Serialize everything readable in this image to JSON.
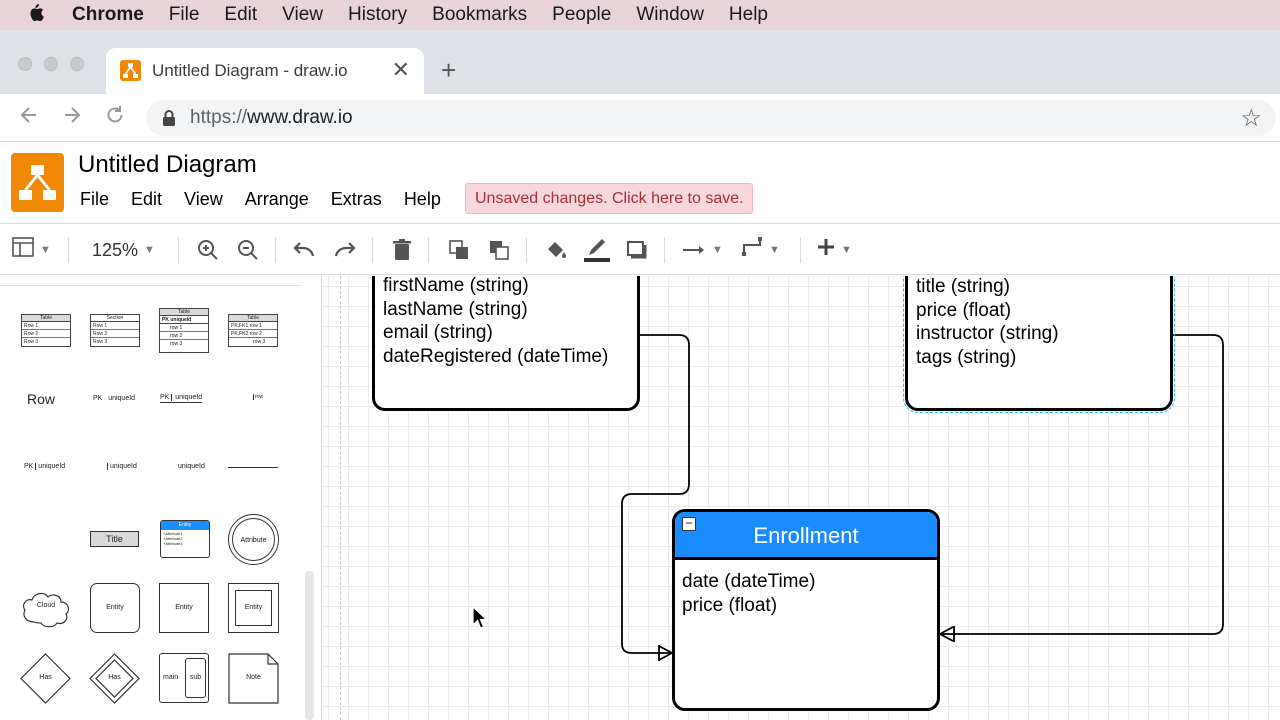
{
  "menubar": {
    "app": "Chrome",
    "items": [
      "File",
      "Edit",
      "View",
      "History",
      "Bookmarks",
      "People",
      "Window",
      "Help"
    ]
  },
  "browser": {
    "tab_title": "Untitled Diagram - draw.io",
    "url_scheme": "https://",
    "url_host": "www.draw.io"
  },
  "app": {
    "title": "Untitled Diagram",
    "menu": [
      "File",
      "Edit",
      "View",
      "Arrange",
      "Extras",
      "Help"
    ],
    "unsaved_notice": "Unsaved changes. Click here to save.",
    "zoom": "125%"
  },
  "sidebar": {
    "tables": [
      "Table",
      "Section",
      "Table",
      "Table"
    ],
    "table_rows": [
      "Row 1",
      "Row 2",
      "Row 3"
    ],
    "table3_header": [
      "PK",
      "uniqueId"
    ],
    "table3_rows": [
      "row 1",
      "row 2",
      "row 3"
    ],
    "table4_rows": [
      "PK,FK1",
      "PK,FK2",
      "row 1",
      "row 2",
      "row 3"
    ],
    "row_label": "Row",
    "pk": "PK",
    "unique_id": "uniqueId",
    "row_small": "row",
    "title_shape": "Title",
    "entity_header": "Entity",
    "entity_attrs": [
      "+Attribute1",
      "+Attribute2",
      "+Attribute3"
    ],
    "attribute": "Attribute",
    "cloud": "Cloud",
    "entity": "Entity",
    "has": "Has",
    "main": "main",
    "sub": "sub",
    "note": "Note"
  },
  "diagram": {
    "student_attrs": [
      "firstName (string)",
      "lastName (string)",
      "email (string)",
      "dateRegistered (dateTime)"
    ],
    "course_attrs": [
      "title (string)",
      "price (float)",
      "instructor (string)",
      "tags (string)"
    ],
    "enrollment_title": "Enrollment",
    "enrollment_attrs": [
      "date (dateTime)",
      "price (float)"
    ],
    "header_color": "#1a8cff"
  }
}
